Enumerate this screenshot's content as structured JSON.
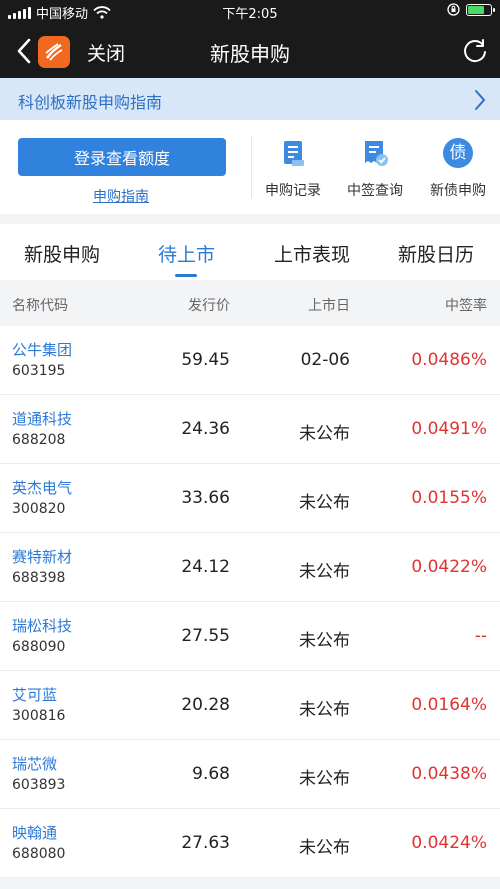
{
  "status_bar": {
    "carrier": "中国移动",
    "time": "下午2:05"
  },
  "nav": {
    "close_label": "关闭",
    "title": "新股申购"
  },
  "banner": {
    "text": "科创板新股申购指南"
  },
  "quick": {
    "login_button": "登录查看额度",
    "guide_link": "申购指南",
    "shortcuts": [
      {
        "label": "申购记录",
        "icon": "document-list-icon"
      },
      {
        "label": "中签查询",
        "icon": "receipt-check-icon"
      },
      {
        "label": "新债申购",
        "icon": "bond-icon",
        "glyph": "债"
      }
    ]
  },
  "tabs": [
    "新股申购",
    "待上市",
    "上市表现",
    "新股日历"
  ],
  "active_tab": 1,
  "table": {
    "headers": [
      "名称代码",
      "发行价",
      "上市日",
      "中签率"
    ],
    "rows": [
      {
        "name": "公牛集团",
        "code": "603195",
        "price": "59.45",
        "date": "02-06",
        "rate": "0.0486%"
      },
      {
        "name": "道通科技",
        "code": "688208",
        "price": "24.36",
        "date": "未公布",
        "rate": "0.0491%"
      },
      {
        "name": "英杰电气",
        "code": "300820",
        "price": "33.66",
        "date": "未公布",
        "rate": "0.0155%"
      },
      {
        "name": "赛特新材",
        "code": "688398",
        "price": "24.12",
        "date": "未公布",
        "rate": "0.0422%"
      },
      {
        "name": "瑞松科技",
        "code": "688090",
        "price": "27.55",
        "date": "未公布",
        "rate": "--"
      },
      {
        "name": "艾可蓝",
        "code": "300816",
        "price": "20.28",
        "date": "未公布",
        "rate": "0.0164%"
      },
      {
        "name": "瑞芯微",
        "code": "603893",
        "price": "9.68",
        "date": "未公布",
        "rate": "0.0438%"
      },
      {
        "name": "映翰通",
        "code": "688080",
        "price": "27.63",
        "date": "未公布",
        "rate": "0.0424%"
      }
    ]
  },
  "colors": {
    "accent": "#2d7ad6",
    "rate": "#e03434",
    "logo": "#f0691f",
    "battery": "#4cd964"
  },
  "battery_level": 0.75
}
